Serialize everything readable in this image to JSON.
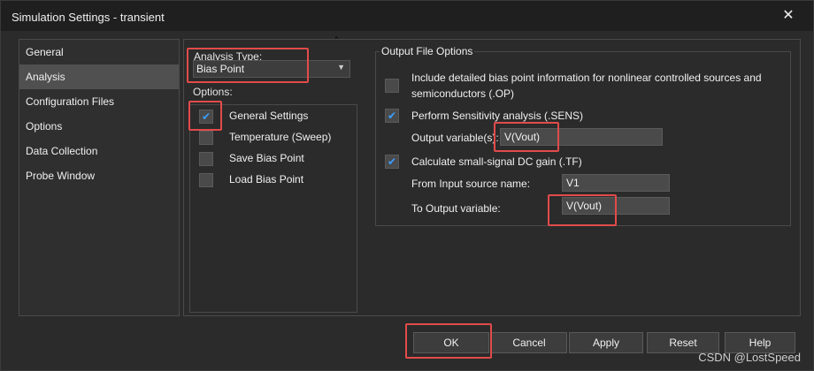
{
  "window": {
    "title": "Simulation Settings - transient",
    "close_glyph": "✕"
  },
  "nav": {
    "items": [
      {
        "label": "General",
        "selected": false
      },
      {
        "label": "Analysis",
        "selected": true
      },
      {
        "label": "Configuration Files",
        "selected": false
      },
      {
        "label": "Options",
        "selected": false
      },
      {
        "label": "Data Collection",
        "selected": false
      },
      {
        "label": "Probe Window",
        "selected": false
      }
    ]
  },
  "analysis": {
    "type_label": "Analysis Type:",
    "type_value": "Bias Point",
    "options_label": "Options:",
    "options": [
      {
        "label": "General Settings",
        "checked": true
      },
      {
        "label": "Temperature (Sweep)",
        "checked": false
      },
      {
        "label": "Save Bias Point",
        "checked": false
      },
      {
        "label": "Load Bias Point",
        "checked": false
      }
    ]
  },
  "output_file_options": {
    "title": "Output File Options",
    "include_detailed_line1": "Include detailed bias point information for nonlinear controlled sources and",
    "include_detailed_line2": "semiconductors (.OP)",
    "include_detailed_checked": false,
    "sens_label": "Perform Sensitivity analysis (.SENS)",
    "sens_checked": true,
    "output_variables_label": "Output variable(s):",
    "output_variables_value": "V(Vout)",
    "tf_label": "Calculate small-signal DC gain (.TF)",
    "tf_checked": true,
    "from_input_label": "From Input source name:",
    "from_input_value": "V1",
    "to_output_label": "To Output variable:",
    "to_output_value": "V(Vout)"
  },
  "buttons": {
    "ok": "OK",
    "cancel": "Cancel",
    "apply": "Apply",
    "reset": "Reset",
    "help": "Help"
  },
  "watermark": "CSDN @LostSpeed",
  "colors": {
    "highlight": "#e24b4b",
    "check_accent": "#3aa0ff",
    "selected_nav": "#505050"
  }
}
